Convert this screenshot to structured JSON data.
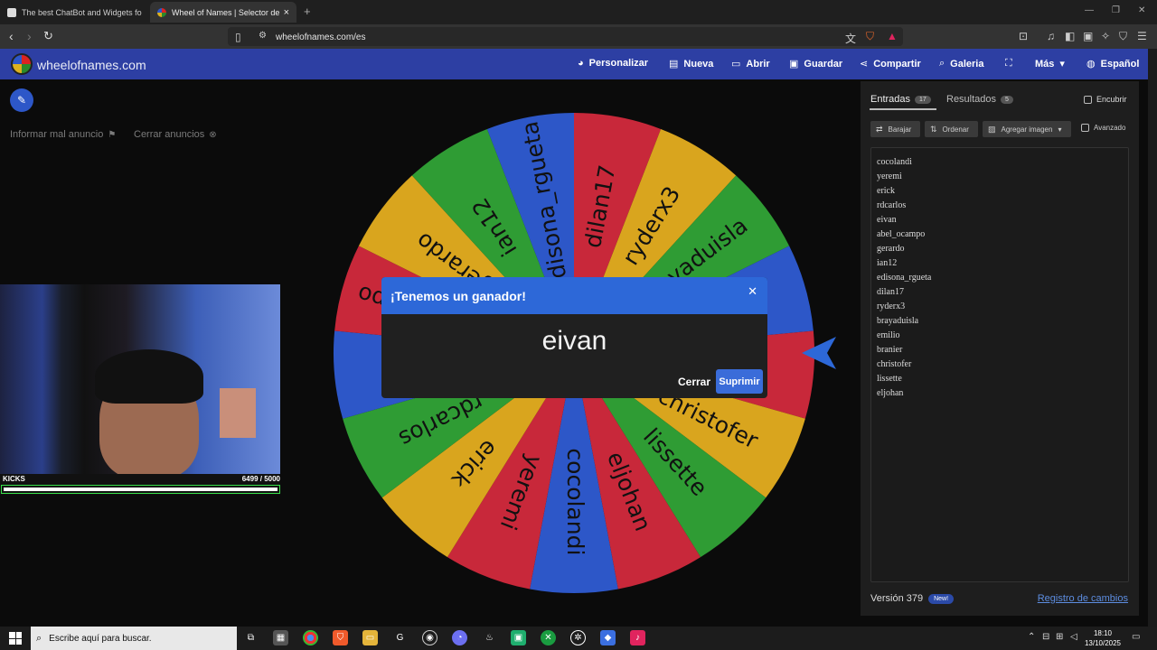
{
  "browser": {
    "tabs": [
      {
        "title": "The best ChatBot and Widgets for Kick"
      },
      {
        "title": "Wheel of Names | Selector de nombres"
      }
    ],
    "new_tab": "+",
    "url": "wheelofnames.com/es"
  },
  "app": {
    "brand": "wheelofnames.com",
    "menu": [
      {
        "icon": "palette-icon",
        "glyph": "◕",
        "label": "Personalizar"
      },
      {
        "icon": "file-icon",
        "glyph": "▤",
        "label": "Nueva"
      },
      {
        "icon": "folder-icon",
        "glyph": "▭",
        "label": "Abrir"
      },
      {
        "icon": "save-icon",
        "glyph": "▣",
        "label": "Guardar"
      },
      {
        "icon": "share-icon",
        "glyph": "⋖",
        "label": "Compartir"
      },
      {
        "icon": "search-icon",
        "glyph": "⌕",
        "label": "Galeria"
      },
      {
        "icon": "fullscreen-icon",
        "glyph": "⛶",
        "label": ""
      },
      {
        "icon": "chevron-down-icon",
        "glyph": "▾",
        "label": "Más"
      },
      {
        "icon": "globe-icon",
        "glyph": "◍",
        "label": "Español"
      }
    ],
    "ads": {
      "report": "Informar mal anuncio",
      "close": "Cerrar anuncios"
    }
  },
  "stream": {
    "label": "KICKS",
    "current": 6499,
    "goal": 5000,
    "count_text": "6499  / 5000",
    "progress": 1.0
  },
  "wheel": {
    "segments": [
      {
        "name": "cocolandi",
        "color": "#2d57c8"
      },
      {
        "name": "yeremi",
        "color": "#c8283a"
      },
      {
        "name": "erick",
        "color": "#d9a51e"
      },
      {
        "name": "rdcarlos",
        "color": "#2f9c34"
      },
      {
        "name": "eivan",
        "color": "#2d57c8"
      },
      {
        "name": "abel_ocampo",
        "color": "#c8283a"
      },
      {
        "name": "gerardo",
        "color": "#d9a51e"
      },
      {
        "name": "ian12",
        "color": "#2f9c34"
      },
      {
        "name": "edisona_rgueta",
        "color": "#2d57c8"
      },
      {
        "name": "dilan17",
        "color": "#c8283a"
      },
      {
        "name": "ryderx3",
        "color": "#d9a51e"
      },
      {
        "name": "brayaduisla",
        "color": "#2f9c34"
      },
      {
        "name": "emilio",
        "color": "#2d57c8"
      },
      {
        "name": "branier",
        "color": "#c8283a"
      },
      {
        "name": "christofer",
        "color": "#d9a51e"
      },
      {
        "name": "lissette",
        "color": "#2f9c34"
      },
      {
        "name": "eljohan",
        "color": "#c8283a"
      }
    ]
  },
  "winner_dialog": {
    "title": "¡Tenemos un ganador!",
    "winner": "eivan",
    "close_label": "Cerrar",
    "remove_label": "Suprimir"
  },
  "panel": {
    "entries_tab": "Entradas",
    "entries_count": "17",
    "results_tab": "Resultados",
    "results_count": "5",
    "hide_label": "Encubrir",
    "shuffle_label": "Barajar",
    "sort_label": "Ordenar",
    "add_image_label": "Agregar imagen",
    "advanced_label": "Avanzado",
    "entries": [
      "cocolandi",
      "yeremi",
      "erick",
      "rdcarlos",
      "eivan",
      "abel_ocampo",
      "gerardo",
      "ian12",
      "edisona_rgueta",
      "dilan17",
      "ryderx3",
      "brayaduisla",
      "emilio",
      "branier",
      "christofer",
      "lissette",
      "eljohan"
    ],
    "version": "Versión 379",
    "new_badge": "New!",
    "changelog": "Registro de cambios"
  },
  "taskbar": {
    "search_placeholder": "Escribe aquí para buscar.",
    "time": "18:10",
    "date": "13/10/2025"
  }
}
